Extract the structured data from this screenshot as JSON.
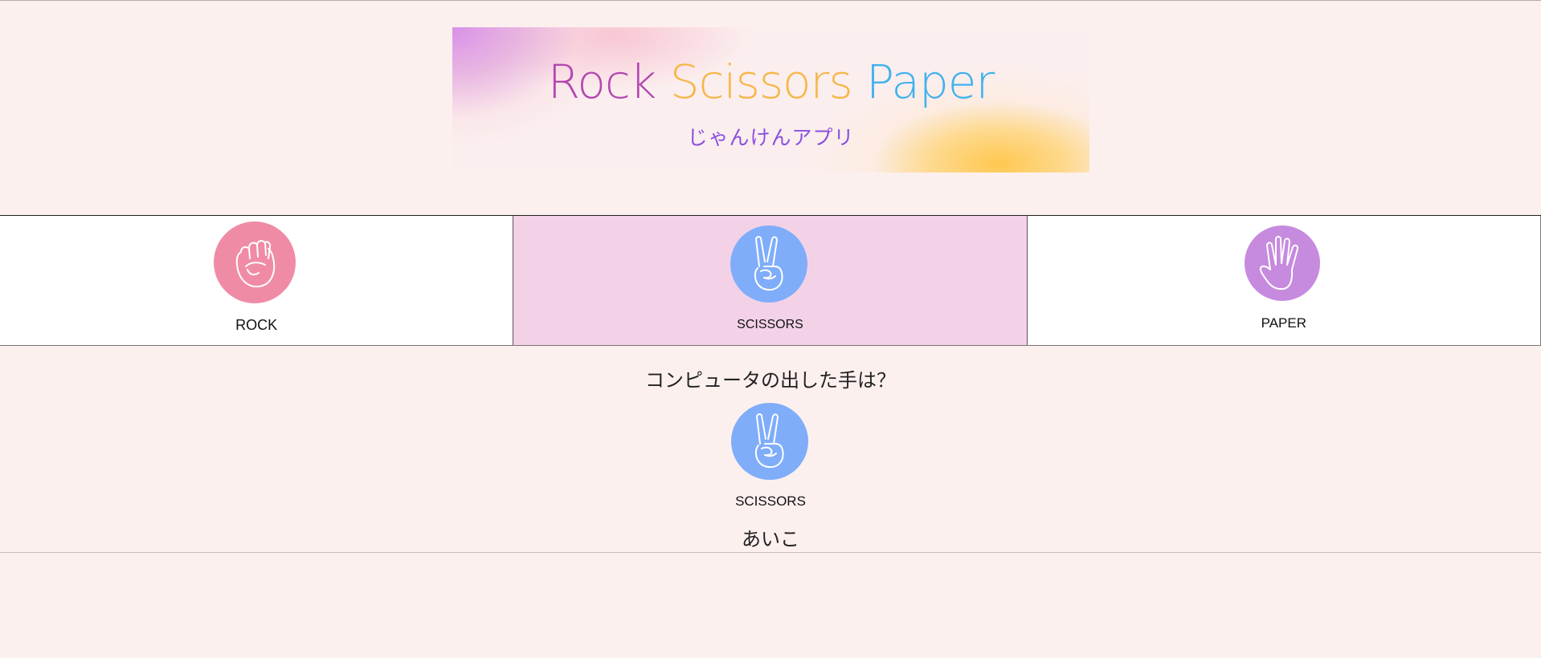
{
  "banner": {
    "title_rock": "Rock",
    "title_scissors": "Scissors",
    "title_paper": "Paper",
    "subtitle": "じゃんけんアプリ"
  },
  "choices": [
    {
      "label": "ROCK",
      "icon": "rock-fist-icon",
      "color": "#f08ba6",
      "selected": false
    },
    {
      "label": "SCISSORS",
      "icon": "scissors-peace-icon",
      "color": "#7fadfa",
      "selected": true
    },
    {
      "label": "PAPER",
      "icon": "paper-hand-icon",
      "color": "#c68adf",
      "selected": false
    }
  ],
  "computer": {
    "question": "コンピュータの出した手は？",
    "hand_label": "SCISSORS",
    "hand_icon": "scissors-peace-icon",
    "hand_color": "#7fadfa"
  },
  "result": {
    "text": "あいこ"
  }
}
